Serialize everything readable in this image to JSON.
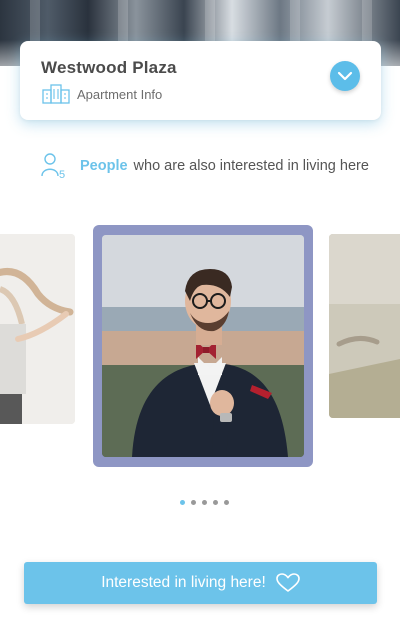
{
  "property": {
    "name": "Westwood Plaza",
    "subtitle": "Apartment Info",
    "icons": {
      "building": "building-icon",
      "toggle": "chevron-down-icon"
    }
  },
  "people": {
    "highlight": "People",
    "text": "who are also interested in living here",
    "badge_count": "5",
    "icon": "person-icon"
  },
  "carousel": {
    "slides": [
      {
        "id": "woman-braid",
        "state": "previous"
      },
      {
        "id": "man-bowtie",
        "state": "current"
      },
      {
        "id": "field-hand",
        "state": "next"
      }
    ],
    "page_count": 5,
    "active_index": 0
  },
  "cta": {
    "label": "Interested in living here!",
    "icon": "heart-icon"
  },
  "colors": {
    "accent": "#6cc3ea",
    "toggle": "#5cbde9",
    "frame": "#8e96c4",
    "text": "#4b4b4b"
  }
}
